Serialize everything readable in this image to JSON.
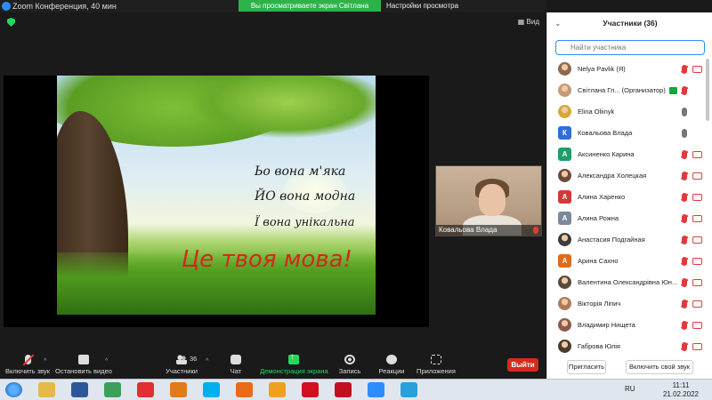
{
  "window": {
    "title": "Zoom Конференция, 40 мин",
    "view_label": "Вид"
  },
  "share_banner": {
    "text": "Вы просматриваете экран Світлана Глазова",
    "view_options": "Настройки просмотра"
  },
  "slide": {
    "line1": "Ьо вона м'яка",
    "line2": "ЙО вона модна",
    "line3": "Ї вона унікальна",
    "line4": "Це твоя мова!"
  },
  "thumbnail": {
    "name": "Ковальова Влада"
  },
  "toolbar": {
    "mute_label": "Включить звук",
    "video_label": "Остановить видео",
    "participants_label": "Участники",
    "participants_count": "36",
    "chat_label": "Чат",
    "share_label": "Демонстрация экрана",
    "record_label": "Запись",
    "reactions_label": "Реакции",
    "apps_label": "Приложения",
    "leave_label": "Выйти"
  },
  "participants_panel": {
    "title": "Участники (36)",
    "search_placeholder": "Найти участника",
    "invite_label": "Пригласить",
    "unmute_self_label": "Включить свой звук",
    "participants": [
      {
        "name": "Nelya Pavlik (Я)",
        "avatar": "photo",
        "color": "#8a6a52",
        "mic": "muted",
        "cam": true,
        "host_badge": false
      },
      {
        "name": "Світлана Гл... (Организатор)",
        "avatar": "photo",
        "color": "#c49a74",
        "mic": "muted",
        "cam": false,
        "host_badge": true
      },
      {
        "name": "Elina Oliinyk",
        "avatar": "photo",
        "color": "#d4a93a",
        "mic": "on",
        "cam": false,
        "host_badge": false
      },
      {
        "name": "Ковальова Влада",
        "avatar": "К",
        "color": "#2d6fd6",
        "mic": "on",
        "cam": false,
        "host_badge": false
      },
      {
        "name": "Аксиненко Карина",
        "avatar": "А",
        "color": "#1f9e6a",
        "mic": "muted",
        "cam": true,
        "host_badge": false
      },
      {
        "name": "Александра Холецкая",
        "avatar": "photo",
        "color": "#6e4a3b",
        "mic": "muted",
        "cam": true,
        "host_badge": false
      },
      {
        "name": "Алина Харенко",
        "avatar": "А",
        "color": "#d23a3a",
        "mic": "muted",
        "cam": true,
        "host_badge": false
      },
      {
        "name": "Алина Рожна",
        "avatar": "А",
        "color": "#7a8a9a",
        "mic": "muted",
        "cam": true,
        "host_badge": false
      },
      {
        "name": "Анастасия Подгайная",
        "avatar": "photo",
        "color": "#3b3b3b",
        "mic": "muted",
        "cam": true,
        "host_badge": false
      },
      {
        "name": "Арина Сахно",
        "avatar": "А",
        "color": "#e06a1a",
        "mic": "muted",
        "cam": true,
        "host_badge": false
      },
      {
        "name": "Валентина Олександрівна Юн...",
        "avatar": "photo",
        "color": "#5a4a3a",
        "mic": "muted",
        "cam": true,
        "host_badge": false
      },
      {
        "name": "Вікторія Ліпич",
        "avatar": "photo",
        "color": "#b07a5a",
        "mic": "muted",
        "cam": true,
        "host_badge": false
      },
      {
        "name": "Владимир Нищета",
        "avatar": "photo",
        "color": "#8a5a4a",
        "mic": "muted",
        "cam": true,
        "host_badge": false
      },
      {
        "name": "Габрова Юлія",
        "avatar": "photo",
        "color": "#4a3a2a",
        "mic": "muted",
        "cam": true,
        "host_badge": false
      }
    ]
  },
  "taskbar": {
    "language": "RU",
    "time": "11:11",
    "date": "21.02.2022",
    "apps": [
      {
        "icon": "start-icon",
        "color": "#2a7fd4"
      },
      {
        "icon": "explorer-icon",
        "color": "#e6b84a"
      },
      {
        "icon": "word-icon",
        "color": "#2b579a"
      },
      {
        "icon": "chrome-icon",
        "color": "#3aa05a"
      },
      {
        "icon": "yandex-browser-icon",
        "color": "#e03030"
      },
      {
        "icon": "media-player-icon",
        "color": "#e07a1a"
      },
      {
        "icon": "skype-icon",
        "color": "#00aff0"
      },
      {
        "icon": "firefox-icon",
        "color": "#e86a1a"
      },
      {
        "icon": "avast-icon",
        "color": "#f0a020"
      },
      {
        "icon": "opera-icon",
        "color": "#d01020"
      },
      {
        "icon": "opera-gx-icon",
        "color": "#c01020"
      },
      {
        "icon": "zoom-icon",
        "color": "#2d8cff"
      },
      {
        "icon": "telegram-icon",
        "color": "#2aa0da"
      }
    ]
  }
}
